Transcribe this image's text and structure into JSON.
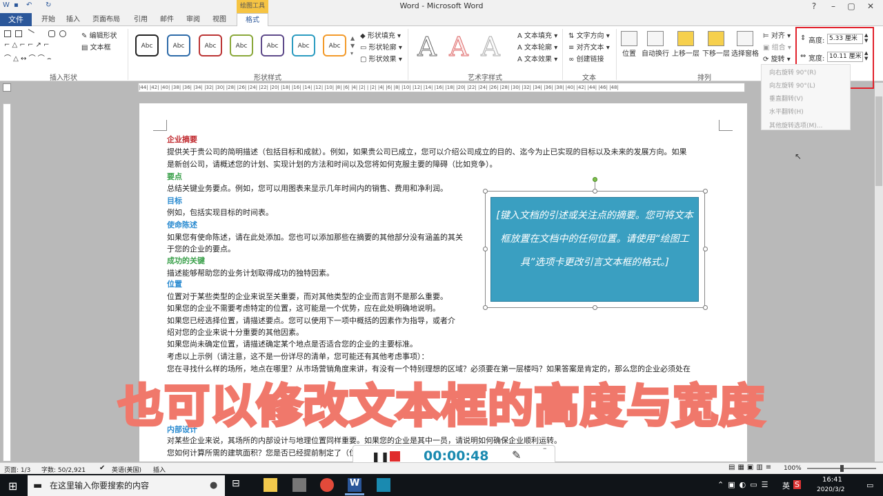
{
  "window": {
    "title": "Word - Microsoft Word",
    "context_tab": "绘图工具"
  },
  "tabs": {
    "file": "文件",
    "home": "开始",
    "insert": "插入",
    "design": "页面布局",
    "references": "引用",
    "mailings": "邮件",
    "review": "审阅",
    "view": "视图",
    "format": "格式"
  },
  "ribbon": {
    "insert_shapes": {
      "edit_shape": "编辑形状",
      "text_box": "文本框",
      "label": "插入形状"
    },
    "shape_styles": {
      "sample": "Abc",
      "fill": "形状填充",
      "outline": "形状轮廓",
      "effects": "形状效果",
      "label": "形状样式"
    },
    "wordart": {
      "sample": "A",
      "text_fill": "文本填充",
      "text_outline": "文本轮廓",
      "text_effects": "文本效果",
      "label": "艺术字样式"
    },
    "text": {
      "direction": "文字方向",
      "align": "对齐文本",
      "link": "创建链接",
      "label": "文本"
    },
    "arrange": {
      "position": "位置",
      "wrap": "自动换行",
      "bring_forward": "上移一层",
      "send_backward": "下移一层",
      "selection_pane": "选择窗格",
      "align": "对齐",
      "group": "组合",
      "rotate": "旋转",
      "label": "排列"
    },
    "size": {
      "height_label": "高度:",
      "height_value": "5.33 厘米",
      "width_label": "宽度:",
      "width_value": "10.11 厘米"
    }
  },
  "rotate_menu": [
    "向右旋转 90°(R)",
    "向左旋转 90°(L)",
    "垂直翻转(V)",
    "水平翻转(H)",
    "其他旋转选项(M)..."
  ],
  "ruler": "|44| |42| |40| |38| |36| |34| |32| |30| |28| |26| |24| |22| |20| |18| |16| |14| |12| |10| |8| |6| |4| |2| | |2| |4| |6| |8| |10| |12| |14| |16| |18| |20| |22| |24| |26| |28| |30| |32| |34| |36| |38| |40| |42| |44| |46| |48|",
  "document": {
    "h1": "企业摘要",
    "p1a": "提供关于贵公司的简明描述（包括目标和成就）。例如，如果贵公司已成立，您可以介绍公司成立的目的、迄今为止已实现的目标以及未来的发展方向。如果",
    "p1b": "是新创公司，请概述您的计划、实现计划的方法和时间以及您将如何克服主要的障碍（比如竞争）。",
    "h2": "要点",
    "p2": "总结关键业务要点。例如，您可以用图表来显示几年时间内的销售、费用和净利润。",
    "h3": "目标",
    "p3": "例如，包括实现目标的时间表。",
    "h4": "使命陈述",
    "p4a": "如果您有使命陈述，请在此处添加。您也可以添加那些在摘要的其他部分没有涵盖的其关",
    "p4b": "于您的企业的要点。",
    "h5": "成功的关键",
    "p5": "描述能够帮助您的业务计划取得成功的独特因素。",
    "h6": "位置",
    "p6a": "位置对于某些类型的企业来说至关重要，而对其他类型的企业而言则不是那么重要。",
    "p6b": "如果您的企业不需要考虑特定的位置，这可能是一个优势，应在此处明确地说明。",
    "p6c": "如果您已经选择位置，请描述要点。您可以使用下一项中概括的因素作为指导，或者介",
    "p6d": "绍对您的企业来说十分重要的其他因素。",
    "p6e": "如果您尚未确定位置，请描述确定某个地点是否适合您的企业的主要标准。",
    "p6f": "考虑以上示例（请注意，这不是一份详尽的清单，您可能还有其他考虑事项）：",
    "p6g": "您在寻找什么样的场所，地点在哪里？从市场营销角度来讲，有没有一个特别理想的区域？必须要在第一层楼吗？如果答案是肯定的，那么您的企业必须处在",
    "h7": "内部设计",
    "p7a": "对某些企业来说，其场所的内部设计与地理位置同样重要。如果您的企业是其中一员，请说明如何确保企业顺利运转。",
    "p7b": "您如何计算所需的建筑面积？您是否已经提前制定了（位置）？"
  },
  "textbox": {
    "text": "[键入文档的引述或关注点的摘要。您可将文本框放置在文档中的任何位置。请使用“绘图工具”选项卡更改引言文本框的格式。]"
  },
  "subtitle": "也可以修改文本框的高度与宽度",
  "recorder": {
    "time": "00:00:48"
  },
  "status": {
    "page": "页面: 1/3",
    "words": "字数: 50/2,921",
    "lang": "英语(美国)",
    "mode": "插入",
    "zoom": "100%"
  },
  "taskbar": {
    "search_placeholder": "在这里输入你要搜索的内容",
    "time": "16:41",
    "date": "2020/3/2",
    "ime": "英"
  }
}
